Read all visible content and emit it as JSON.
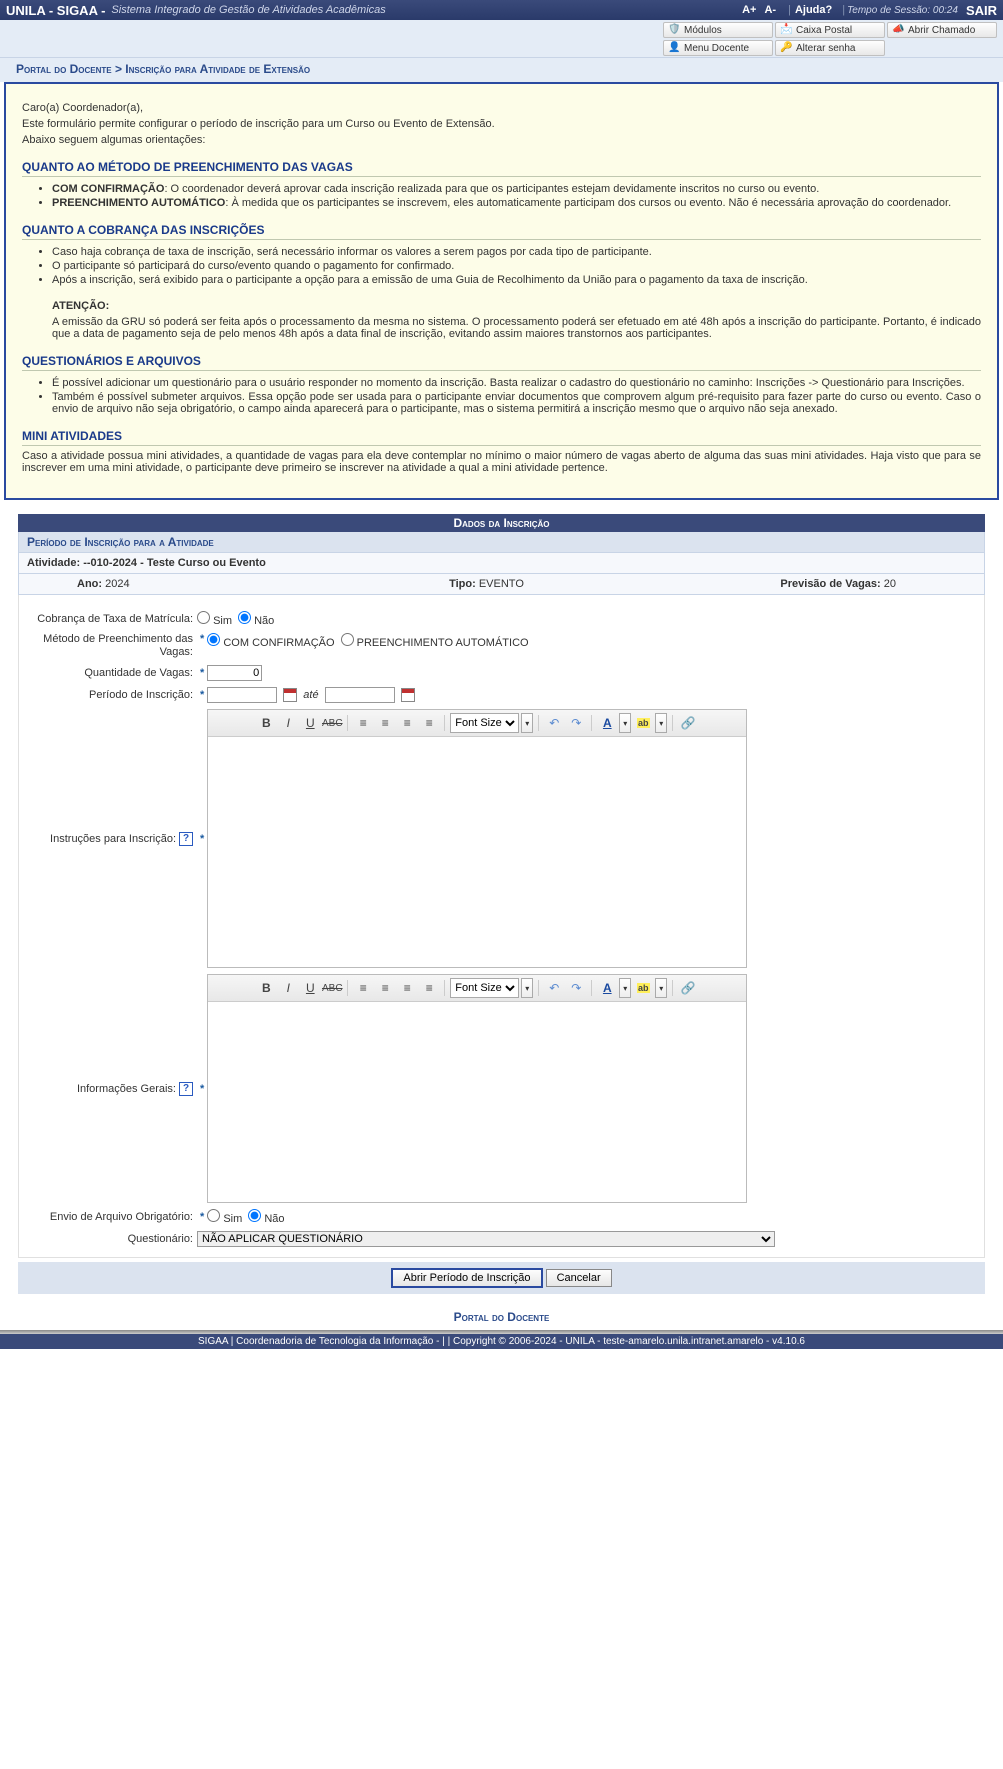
{
  "top": {
    "brand": "UNILA - SIGAA -",
    "subtitle": "Sistema Integrado de Gestão de Atividades Acadêmicas",
    "zoom_in": "A+",
    "zoom_out": "A-",
    "help": "Ajuda?",
    "session_label": "Tempo de Sessão:",
    "session_time": "00:24",
    "logout": "SAIR"
  },
  "menu": {
    "modulos": "Módulos",
    "caixa": "Caixa Postal",
    "chamado": "Abrir Chamado",
    "docente": "Menu Docente",
    "senha": "Alterar senha"
  },
  "breadcrumb": "Portal do Docente > Inscrição para Atividade de Extensão",
  "info": {
    "greet": "Caro(a) Coordenador(a),",
    "p1": "Este formulário permite configurar o período de inscrição para um Curso ou Evento de Extensão.",
    "p2": "Abaixo seguem algumas orientações:",
    "h1": "QUANTO AO MÉTODO DE PREENCHIMENTO DAS VAGAS",
    "l1a_b": "COM CONFIRMAÇÃO",
    "l1a": ": O coordenador deverá aprovar cada inscrição realizada para que os participantes estejam devidamente inscritos no curso ou evento.",
    "l1b_b": "PREENCHIMENTO AUTOMÁTICO",
    "l1b": ": À medida que os participantes se inscrevem, eles automaticamente participam dos cursos ou evento. Não é necessária aprovação do coordenador.",
    "h2": "QUANTO A COBRANÇA DAS INSCRIÇÕES",
    "l2a": "Caso haja cobrança de taxa de inscrição, será necessário informar os valores a serem pagos por cada tipo de participante.",
    "l2b": "O participante só participará do curso/evento quando o pagamento for confirmado.",
    "l2c": "Após a inscrição, será exibido para o participante a opção para a emissão de uma Guia de Recolhimento da União para o pagamento da taxa de inscrição.",
    "att_h": "ATENÇÃO:",
    "att_p": "A emissão da GRU só poderá ser feita após o processamento da mesma no sistema. O processamento poderá ser efetuado em até 48h após a inscrição do participante. Portanto, é indicado que a data de pagamento seja de pelo menos 48h após a data final de inscrição, evitando assim maiores transtornos aos participantes.",
    "h3": "QUESTIONÁRIOS E ARQUIVOS",
    "l3a": "É possível adicionar um questionário para o usuário responder no momento da inscrição. Basta realizar o cadastro do questionário no caminho: Inscrições -> Questionário para Inscrições.",
    "l3b": "Também é possível submeter arquivos. Essa opção pode ser usada para o participante enviar documentos que comprovem algum pré-requisito para fazer parte do curso ou evento. Caso o envio de arquivo não seja obrigatório, o campo ainda aparecerá para o participante, mas o sistema permitirá a inscrição mesmo que o arquivo não seja anexado.",
    "h4": "MINI ATIVIDADES",
    "p4": "Caso a atividade possua mini atividades, a quantidade de vagas para ela deve contemplar no mínimo o maior número de vagas aberto de alguma das suas mini atividades. Haja visto que para se inscrever em uma mini atividade, o participante deve primeiro se inscrever na atividade a qual a mini atividade pertence."
  },
  "form": {
    "title": "Dados da Inscrição",
    "subtitle": "Período de Inscrição para a Atividade",
    "activity_lbl": "Atividade: ",
    "activity_val": "--010-2024 - Teste Curso ou Evento",
    "ano_lbl": "Ano: ",
    "ano_val": "2024",
    "tipo_lbl": "Tipo: ",
    "tipo_val": "EVENTO",
    "prev_lbl": "Previsão de Vagas: ",
    "prev_val": "20",
    "cobranca_lbl": "Cobrança de Taxa de Matrícula:",
    "sim": "Sim",
    "nao": "Não",
    "metodo_lbl": "Método de Preenchimento das Vagas:",
    "metodo_a": "COM CONFIRMAÇÃO",
    "metodo_b": "PREENCHIMENTO AUTOMÁTICO",
    "qtd_lbl": "Quantidade de Vagas:",
    "qtd_val": "0",
    "periodo_lbl": "Período de Inscrição:",
    "ate": "até",
    "instr_lbl": "Instruções para Inscrição:",
    "gerais_lbl": "Informações Gerais:",
    "envio_lbl": "Envio de Arquivo Obrigatório:",
    "quest_lbl": "Questionário:",
    "quest_val": "NÃO APLICAR QUESTIONÁRIO",
    "fontsize": "Font Size",
    "btn_open": "Abrir Período de Inscrição",
    "btn_cancel": "Cancelar"
  },
  "portal_link": "Portal do Docente",
  "footer": "SIGAA | Coordenadoria de Tecnologia da Informação - | | Copyright © 2006-2024 - UNILA - teste-amarelo.unila.intranet.amarelo - v4.10.6"
}
